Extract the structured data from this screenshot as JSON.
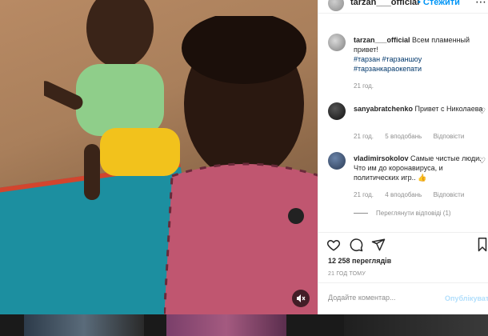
{
  "post": {
    "username": "tarzan___official",
    "follow_label": "• Стежити",
    "more_icon": "more-horizontal-icon",
    "caption": {
      "username": "tarzan___official",
      "text": "Всем пламенный привет!",
      "tags": [
        "#тарзан #тарзаншоу",
        "#тарзанкараокепати"
      ],
      "time": "21 год."
    }
  },
  "comments": [
    {
      "username": "sanyabratchenko",
      "text": "Привет с Николаева",
      "time": "21 год.",
      "likes": "5 вподобань",
      "reply": "Відповісти"
    },
    {
      "username": "vladimirsokolov",
      "text": "Самые чистые люди. Что им до коронавируса, и политических игр.. 👍",
      "time": "21 год.",
      "likes": "4 вподобань",
      "reply": "Відповісти",
      "view_replies": "Переглянути відповіді (1)"
    }
  ],
  "actions": {
    "icons": [
      "heart-icon",
      "comment-icon",
      "share-icon",
      "bookmark-icon"
    ],
    "views": "12 258 переглядів",
    "timestamp": "21 ГОД ТОМУ"
  },
  "comment_box": {
    "placeholder": "Додайте коментар...",
    "post_label": "Опублікувати"
  },
  "colors": {
    "accent": "#0095f6",
    "link": "#00376b",
    "muted": "#8e8e8e",
    "mat": "#1c8fa0"
  }
}
